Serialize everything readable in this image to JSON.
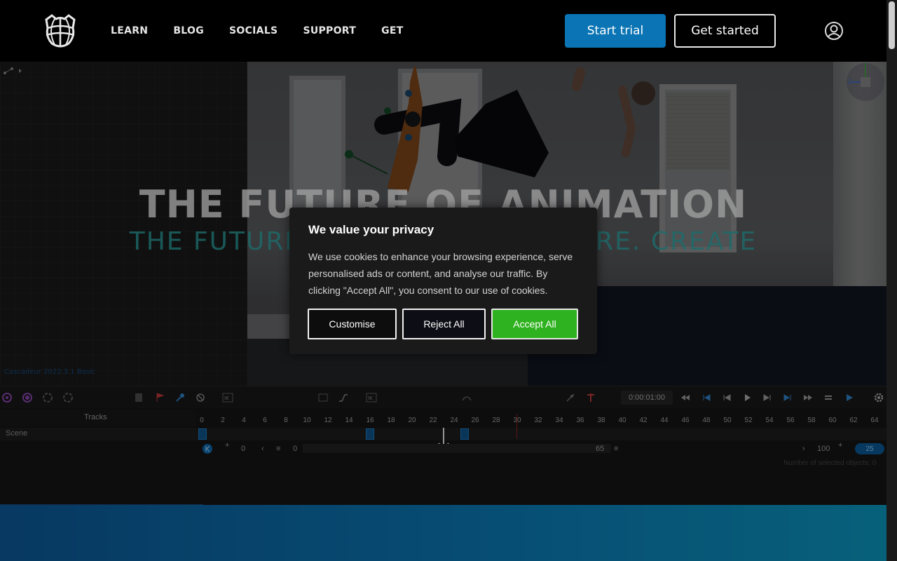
{
  "header": {
    "nav": [
      "LEARN",
      "BLOG",
      "SOCIALS",
      "SUPPORT",
      "GET"
    ],
    "start_trial": "Start trial",
    "get_started": "Get started",
    "brand_color": "#0a74b4"
  },
  "hero": {
    "title": "THE FUTURE OF ANIMATION",
    "subtitle": "THE FUTURE OF ANIMATION IS HERE. CREATE",
    "version": "Cascadeur 2022.3.1 Basic"
  },
  "timeline": {
    "time": "0:00:01:00",
    "tracks_label": "Tracks",
    "scene_label": "Scene",
    "ruler_ticks": [
      "0",
      "2",
      "4",
      "6",
      "8",
      "10",
      "12",
      "14",
      "16",
      "18",
      "20",
      "22",
      "24",
      "26",
      "28",
      "30",
      "32",
      "34",
      "36",
      "38",
      "40",
      "42",
      "44",
      "46",
      "48",
      "50",
      "52",
      "54",
      "56",
      "58",
      "60",
      "62",
      "64"
    ],
    "range_start": "0",
    "range_start2": "0",
    "range_end": "65",
    "range_total": "100",
    "fps": "25",
    "selected": "Number of selected objects: 0"
  },
  "cookie": {
    "title": "We value your privacy",
    "body": "We use cookies to enhance your browsing experience, serve personalised ads or content, and analyse our traffic. By clicking \"Accept All\", you consent to our use of cookies.",
    "customise": "Customise",
    "reject": "Reject All",
    "accept": "Accept All",
    "accept_color": "#2fb21f"
  }
}
